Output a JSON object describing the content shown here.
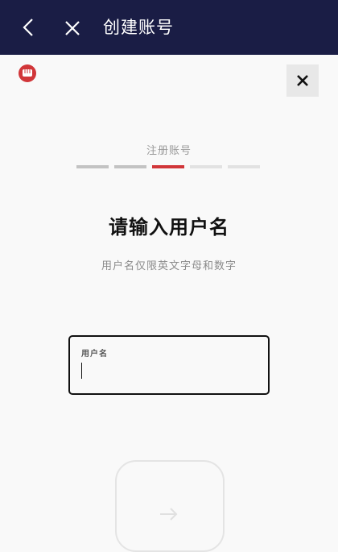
{
  "topbar": {
    "title": "创建账号",
    "back_icon": "chevron-left-icon",
    "close_icon": "close-icon",
    "background": "#1a1d45"
  },
  "brand": {
    "logo_icon": "fist-logo-icon",
    "color": "#d13639"
  },
  "dialog": {
    "close_icon": "close-icon"
  },
  "steps": {
    "label": "注册账号",
    "total": 5,
    "current": 3,
    "active_color": "#d13639",
    "done_color": "#c3c3c3",
    "pending_color": "#e2e2e2"
  },
  "heading": "请输入用户名",
  "subheading": "用户名仅限英文字母和数字",
  "username_field": {
    "label": "用户名",
    "value": ""
  },
  "next_button": {
    "icon": "arrow-right-icon"
  }
}
